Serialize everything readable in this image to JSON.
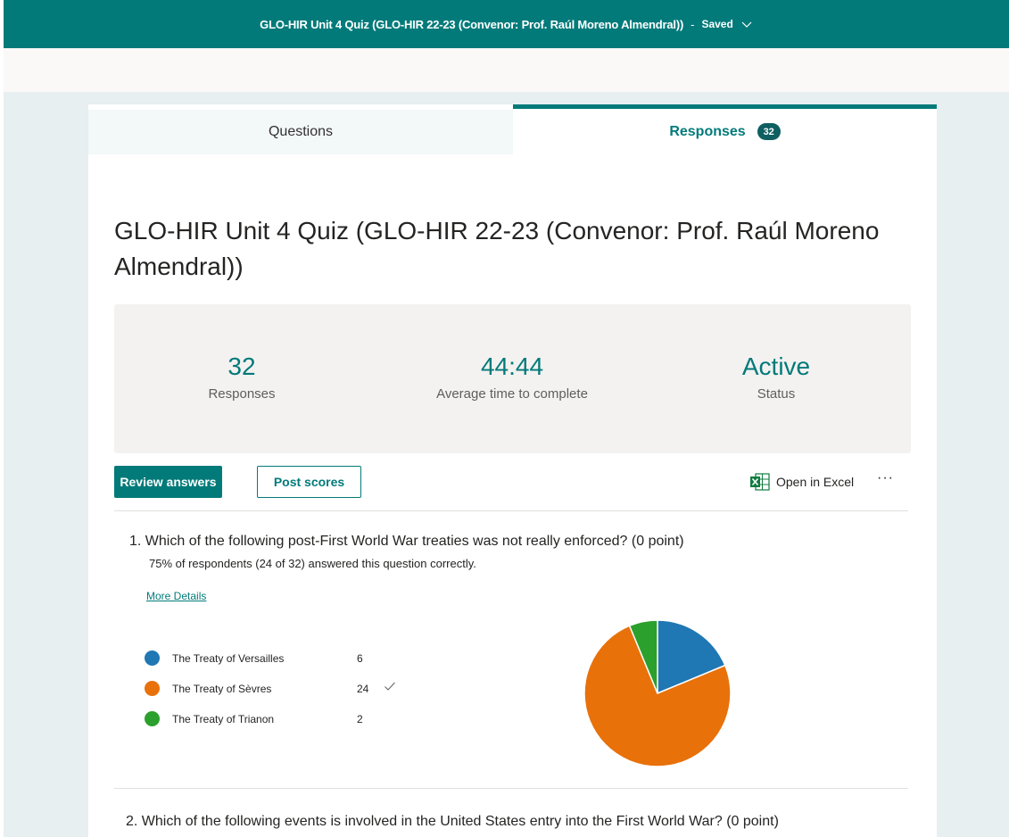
{
  "header": {
    "title": "GLO-HIR Unit 4 Quiz (GLO-HIR 22-23 (Convenor: Prof. Raúl Moreno Almendral))",
    "separator": "-",
    "status": "Saved"
  },
  "tabs": {
    "questions_label": "Questions",
    "responses_label": "Responses",
    "responses_count": "32"
  },
  "form_title": "GLO-HIR Unit 4 Quiz (GLO-HIR 22-23 (Convenor: Prof. Raúl Moreno Almendral))",
  "stats": {
    "responses_value": "32",
    "responses_label": "Responses",
    "avg_time_value": "44:44",
    "avg_time_label": "Average time to complete",
    "status_value": "Active",
    "status_label": "Status"
  },
  "actions": {
    "review_label": "Review answers",
    "post_label": "Post scores",
    "excel_label": "Open in Excel",
    "more_label": "···"
  },
  "question1": {
    "text": "1. Which of the following post-First World War treaties was not really enforced? (0 point)",
    "summary": "75% of respondents (24 of 32) answered this question correctly.",
    "details_link": "More Details",
    "options": [
      {
        "label": "The Treaty of Versailles",
        "count": "6",
        "color": "#1f77b4",
        "correct": false
      },
      {
        "label": "The Treaty of Sèvres",
        "count": "24",
        "color": "#e8710a",
        "correct": true
      },
      {
        "label": "The Treaty of Trianon",
        "count": "2",
        "color": "#2ca02c",
        "correct": false
      }
    ]
  },
  "question2": {
    "text": "2. Which of the following events is involved in the United States entry into the First World War? (0 point)"
  },
  "chart_data": {
    "type": "pie",
    "categories": [
      "The Treaty of Versailles",
      "The Treaty of Sèvres",
      "The Treaty of Trianon"
    ],
    "values": [
      6,
      24,
      2
    ],
    "colors": [
      "#1f77b4",
      "#e8710a",
      "#2ca02c"
    ]
  }
}
